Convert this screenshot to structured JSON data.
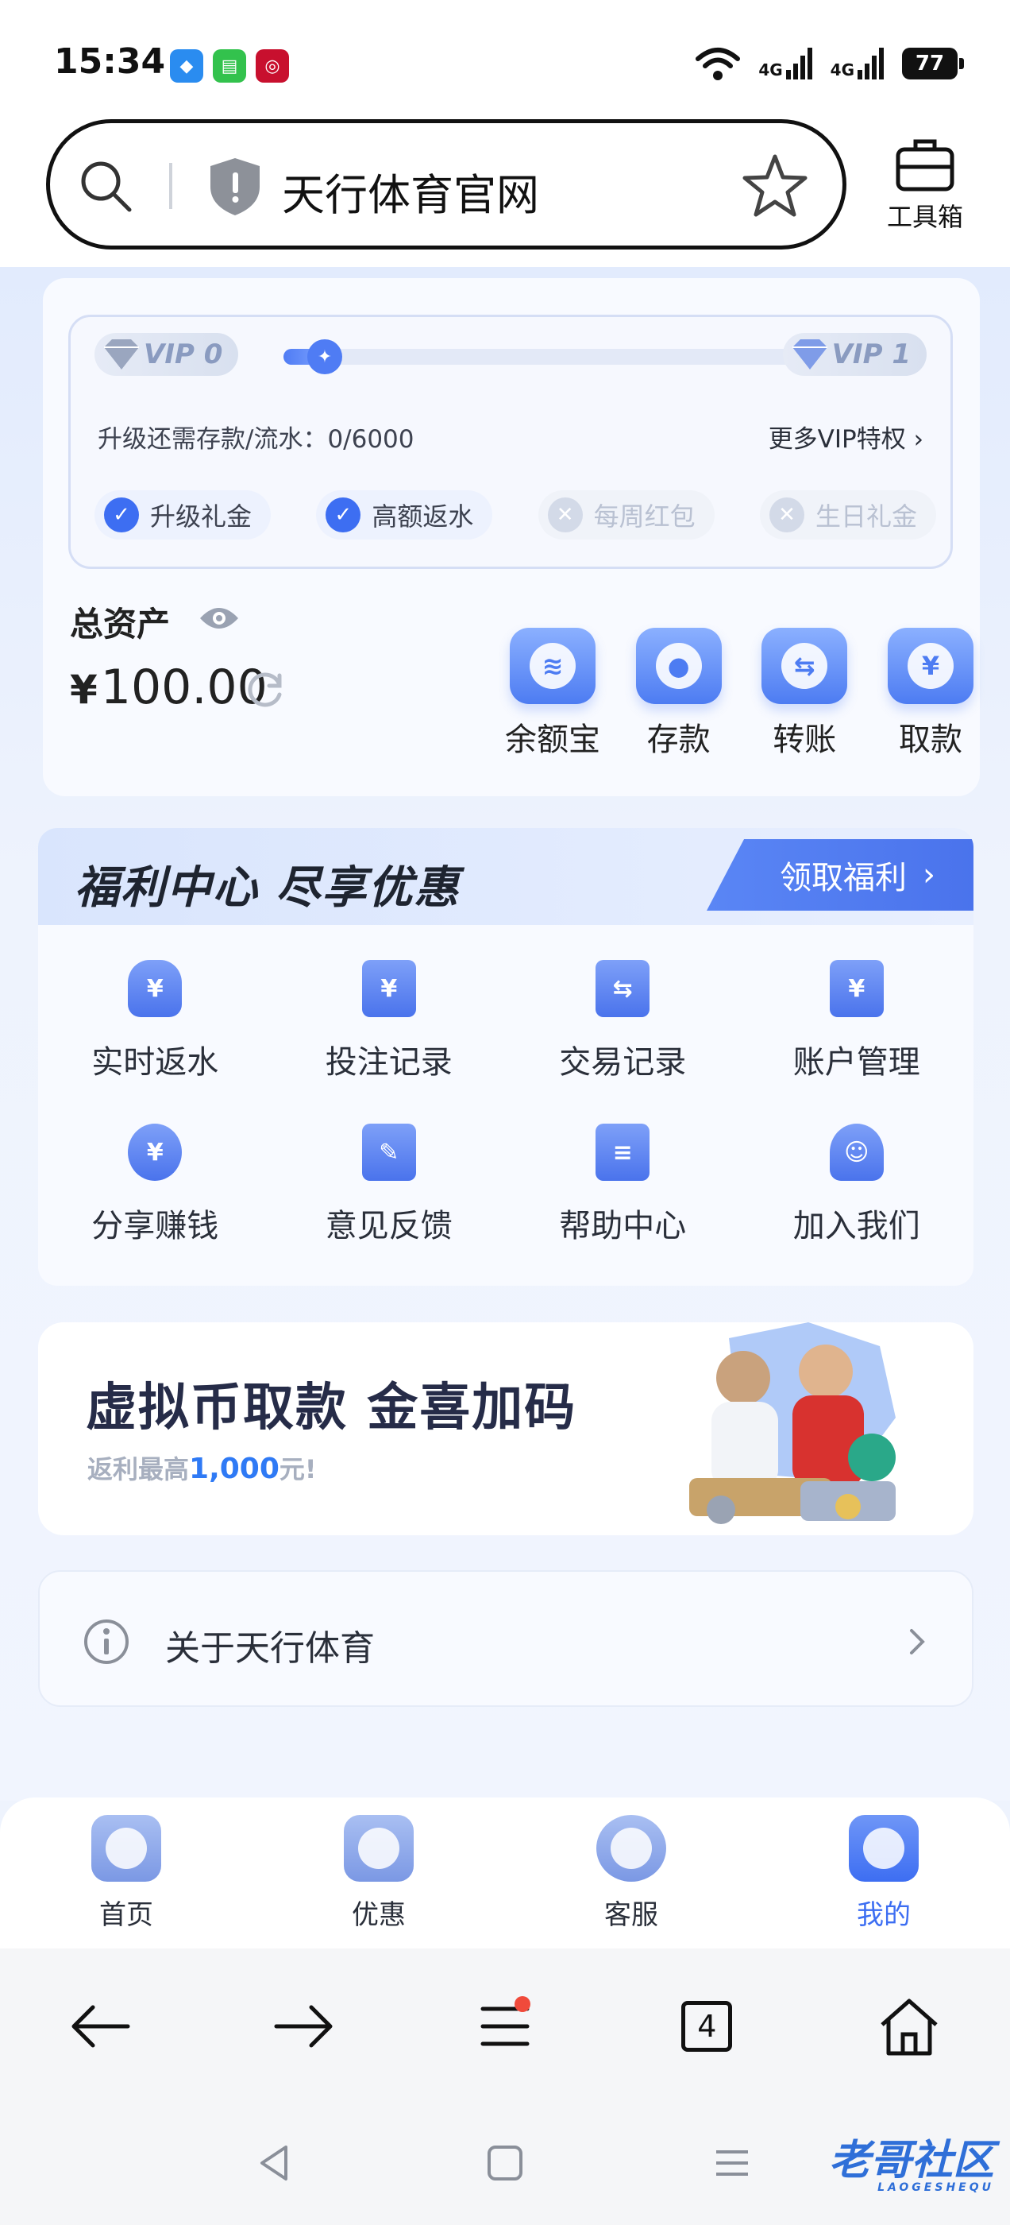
{
  "status_bar": {
    "time": "15:34",
    "network_1": "4G",
    "network_2": "4G",
    "battery": "77"
  },
  "browser": {
    "url_text": "天行体育官网",
    "toolbox_label": "工具箱",
    "tab_count": "4"
  },
  "vip": {
    "current_level": "VIP 0",
    "next_level": "VIP 1",
    "progress_fraction": 0.0,
    "upgrade_text": "升级还需存款/流水：0/6000",
    "more_link": "更多VIP特权",
    "perks": [
      {
        "label": "升级礼金",
        "enabled": true
      },
      {
        "label": "高额返水",
        "enabled": true
      },
      {
        "label": "每周红包",
        "enabled": false
      },
      {
        "label": "生日礼金",
        "enabled": false
      }
    ]
  },
  "assets": {
    "label": "总资产",
    "currency": "¥",
    "amount": "100.00"
  },
  "quick_actions": [
    {
      "label": "余额宝",
      "icon": "stack-coins-icon",
      "glyph": "≋"
    },
    {
      "label": "存款",
      "icon": "deposit-toggle-icon",
      "glyph": "●"
    },
    {
      "label": "转账",
      "icon": "transfer-icon",
      "glyph": "⇆"
    },
    {
      "label": "取款",
      "icon": "withdraw-yen-icon",
      "glyph": "¥"
    }
  ],
  "welfare": {
    "title": "福利中心  尽享优惠",
    "claim_button": "领取福利",
    "items": [
      {
        "label": "实时返水",
        "icon": "money-bag-icon",
        "glyph": "¥"
      },
      {
        "label": "投注记录",
        "icon": "bet-record-icon",
        "glyph": "¥"
      },
      {
        "label": "交易记录",
        "icon": "transaction-record-icon",
        "glyph": "⇆"
      },
      {
        "label": "账户管理",
        "icon": "account-folder-icon",
        "glyph": "¥"
      },
      {
        "label": "分享赚钱",
        "icon": "hand-coin-icon",
        "glyph": "¥"
      },
      {
        "label": "意见反馈",
        "icon": "feedback-note-icon",
        "glyph": "✎"
      },
      {
        "label": "帮助中心",
        "icon": "help-book-icon",
        "glyph": "≡"
      },
      {
        "label": "加入我们",
        "icon": "join-users-icon",
        "glyph": "☺"
      }
    ]
  },
  "banner": {
    "title": "虚拟币取款 金喜加码",
    "subtitle_prefix": "返利最高",
    "subtitle_highlight": "1,000",
    "subtitle_suffix": "元!"
  },
  "about": {
    "label": "关于天行体育"
  },
  "tabbar": {
    "items": [
      {
        "label": "首页",
        "icon": "home-icon",
        "active": false
      },
      {
        "label": "优惠",
        "icon": "promo-gift-icon",
        "active": false
      },
      {
        "label": "客服",
        "icon": "headset-icon",
        "active": false
      },
      {
        "label": "我的",
        "icon": "user-profile-icon",
        "active": true
      }
    ]
  },
  "watermark": {
    "text": "老哥社区",
    "sub": "LAOGESHEQU"
  },
  "colors": {
    "accent": "#3d6ef2",
    "page_bg": "#eef3fd"
  }
}
